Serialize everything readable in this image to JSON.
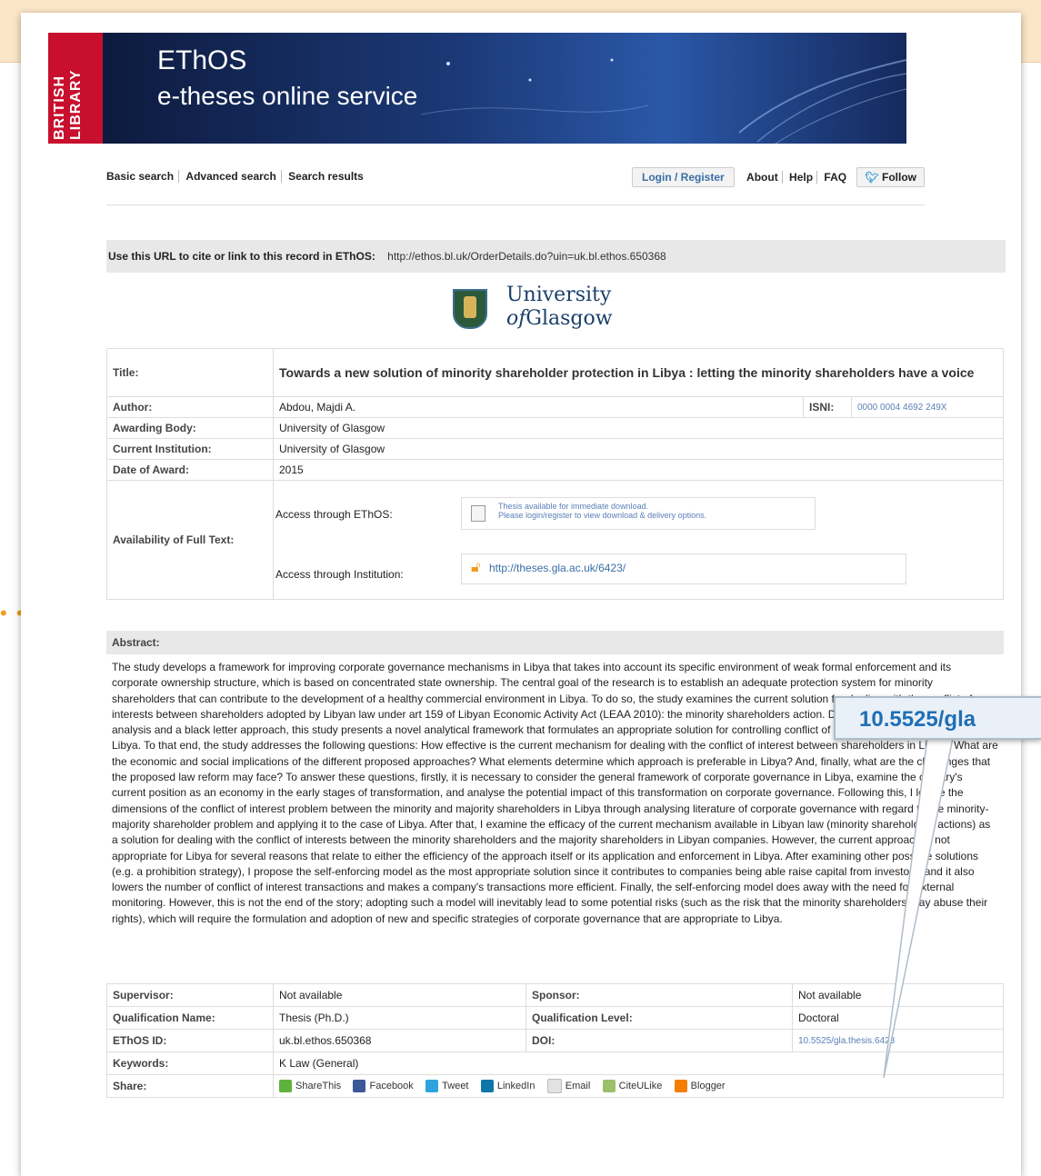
{
  "logo": {
    "line1": "BRITISH",
    "line2": "LIBRARY"
  },
  "banner": {
    "title": "EThOS",
    "subtitle": "e-theses online service"
  },
  "nav": {
    "left": [
      "Basic search",
      "Advanced search",
      "Search results"
    ],
    "login": "Login / Register",
    "links": [
      "About",
      "Help",
      "FAQ"
    ],
    "follow": "Follow"
  },
  "cite": {
    "label": "Use this URL to cite or link to this record in EThOS:",
    "url": "http://ethos.bl.uk/OrderDetails.do?uin=uk.bl.ethos.650368"
  },
  "university": {
    "line1": "University",
    "line2_of": "of",
    "line2_rest": "Glasgow"
  },
  "record": {
    "title_label": "Title:",
    "title": "Towards a new solution of minority shareholder protection in Libya : letting the minority shareholders have a voice",
    "author_label": "Author:",
    "author": "Abdou, Majdi A.",
    "isni_label": "ISNI:",
    "isni": "0000 0004 4692 249X",
    "awarding_label": "Awarding Body:",
    "awarding": "University of Glasgow",
    "institution_label": "Current Institution:",
    "institution": "University of Glasgow",
    "date_label": "Date of Award:",
    "date": "2015",
    "availability_label": "Availability of Full Text:",
    "access_ethos_label": "Access through EThOS:",
    "access_ethos_line1": "Thesis available for immediate download.",
    "access_ethos_line2": "Please login/register to view download & delivery options.",
    "access_inst_label": "Access through Institution:",
    "access_inst_url": "http://theses.gla.ac.uk/6423/"
  },
  "abstract": {
    "label": "Abstract:",
    "text": "The study develops a framework for improving corporate governance mechanisms in Libya that takes into account its specific environment of weak formal enforcement and its corporate ownership structure, which is based on concentrated state ownership. The central goal of the research is to establish an adequate protection system for minority shareholders that can contribute to the development of a healthy commercial environment in Libya. To do so, the study examines the current solution for dealing with the conflict of interests between shareholders adopted by Libyan law under art 159 of Libyan Economic Activity Act (LEAA 2010): the minority shareholders action. Drawing on a social and economic analysis and a black letter approach, this study presents a novel analytical framework that formulates an appropriate solution for controlling conflict of interests between shareholders in Libya. To that end, the study addresses the following questions: How effective is the current mechanism for dealing with the conflict of interest between shareholders in Libya? What are the economic and social implications of the different proposed approaches? What elements determine which approach is preferable in Libya? And, finally, what are the challenges that the proposed law reform may face? To answer these questions, firstly, it is necessary to consider the general framework of corporate governance in Libya, examine the country's current position as an economy in the early stages of transformation, and analyse the potential impact of this transformation on corporate governance. Following this, I locate the dimensions of the conflict of interest problem between the minority and majority shareholders in Libya through analysing literature of corporate governance with regard to the minority-majority shareholder problem and applying it to the case of Libya. After that, I examine the efficacy of the current mechanism available in Libyan law (minority shareholders actions) as a solution for dealing with the conflict of interests between the minority shareholders and the majority shareholders in Libyan companies. However, the current approach is not appropriate for Libya for several reasons that relate to either the efficiency of the approach itself or its application and enforcement in Libya. After examining other possible solutions (e.g. a prohibition strategy), I propose the self-enforcing model as the most appropriate solution since it contributes to companies being able raise capital from investors, and it also lowers the number of conflict of interest transactions and makes a company's transactions more efficient. Finally, the self-enforcing model does away with the need for external monitoring. However, this is not the end of the story; adopting such a model will inevitably lead to some potential risks (such as the risk that the minority shareholders may abuse their rights), which will require the formulation and adoption of new and specific strategies of corporate governance that are appropriate to Libya."
  },
  "details": {
    "supervisor_label": "Supervisor:",
    "supervisor": "Not available",
    "sponsor_label": "Sponsor:",
    "sponsor": "Not available",
    "qual_name_label": "Qualification Name:",
    "qual_name": "Thesis (Ph.D.)",
    "qual_level_label": "Qualification Level:",
    "qual_level": "Doctoral",
    "ethos_id_label": "EThOS ID:",
    "ethos_id": "uk.bl.ethos.650368",
    "doi_label": "DOI:",
    "doi": "10.5525/gla.thesis.6423",
    "keywords_label": "Keywords:",
    "keywords": "K Law (General)",
    "share_label": "Share:",
    "share": [
      "ShareThis",
      "Facebook",
      "Tweet",
      "LinkedIn",
      "Email",
      "CiteULike",
      "Blogger"
    ]
  },
  "callout": {
    "text": "10.5525/gla"
  },
  "colors": {
    "accent": "#1f6fb5",
    "band": "#fbe6c8",
    "brand_red": "#c8102e"
  }
}
